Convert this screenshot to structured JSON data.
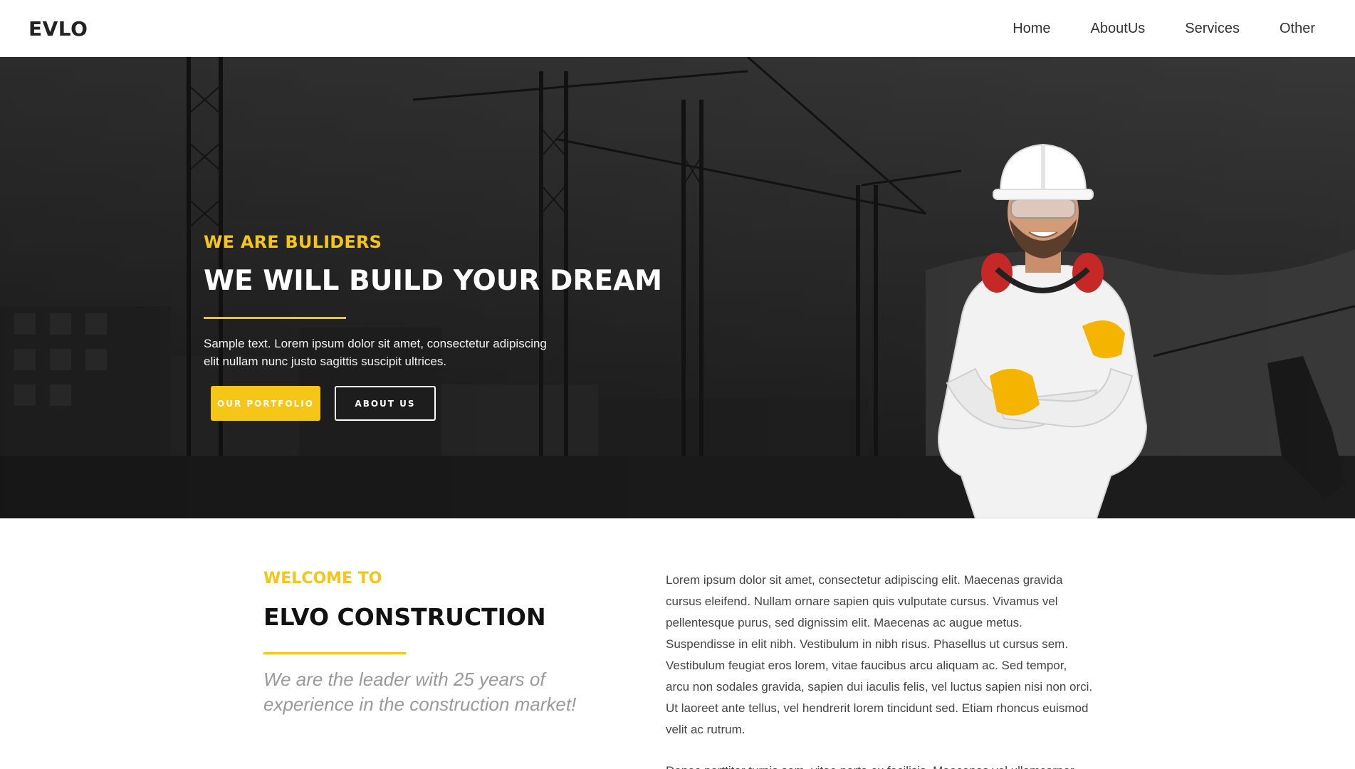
{
  "header": {
    "logo": "EVLO",
    "nav": [
      "Home",
      "AboutUs",
      "Services",
      "Other"
    ]
  },
  "hero": {
    "eyebrow": "WE ARE BULIDERS",
    "title": "WE WILL BUILD YOUR DREAM",
    "text": "Sample text. Lorem ipsum dolor sit amet, consectetur adipiscing elit nullam nunc justo sagittis suscipit ultrices.",
    "primary_button": "OUR PORTFOLIO",
    "secondary_button": "ABOUT US"
  },
  "about": {
    "eyebrow": "WELCOME TO",
    "title": "ELVO CONSTRUCTION",
    "quote": "We are the leader with 25 years of experience in the construction market!",
    "body": "Lorem ipsum dolor sit amet, consectetur adipiscing elit. Maecenas gravida cursus eleifend. Nullam ornare sapien quis vulputate cursus. Vivamus vel pellentesque purus, sed dignissim elit. Maecenas ac augue metus. Suspendisse in elit nibh. Vestibulum in nibh risus. Phasellus ut cursus sem. Vestibulum feugiat eros lorem, vitae faucibus arcu aliquam ac. Sed tempor, arcu non sodales gravida, sapien dui iaculis felis, vel luctus sapien nisi non orci. Ut laoreet ante tellus, vel hendrerit lorem tincidunt sed. Etiam rhoncus euismod velit ac rutrum.",
    "body_2": "Donec porttitor turpis sem, vitae porta ex facilisis. Maecenas vel ullamcorper ultrices justo."
  },
  "colors": {
    "accent": "#f5c518",
    "dark": "#111111",
    "muted": "#9a9a9a"
  }
}
